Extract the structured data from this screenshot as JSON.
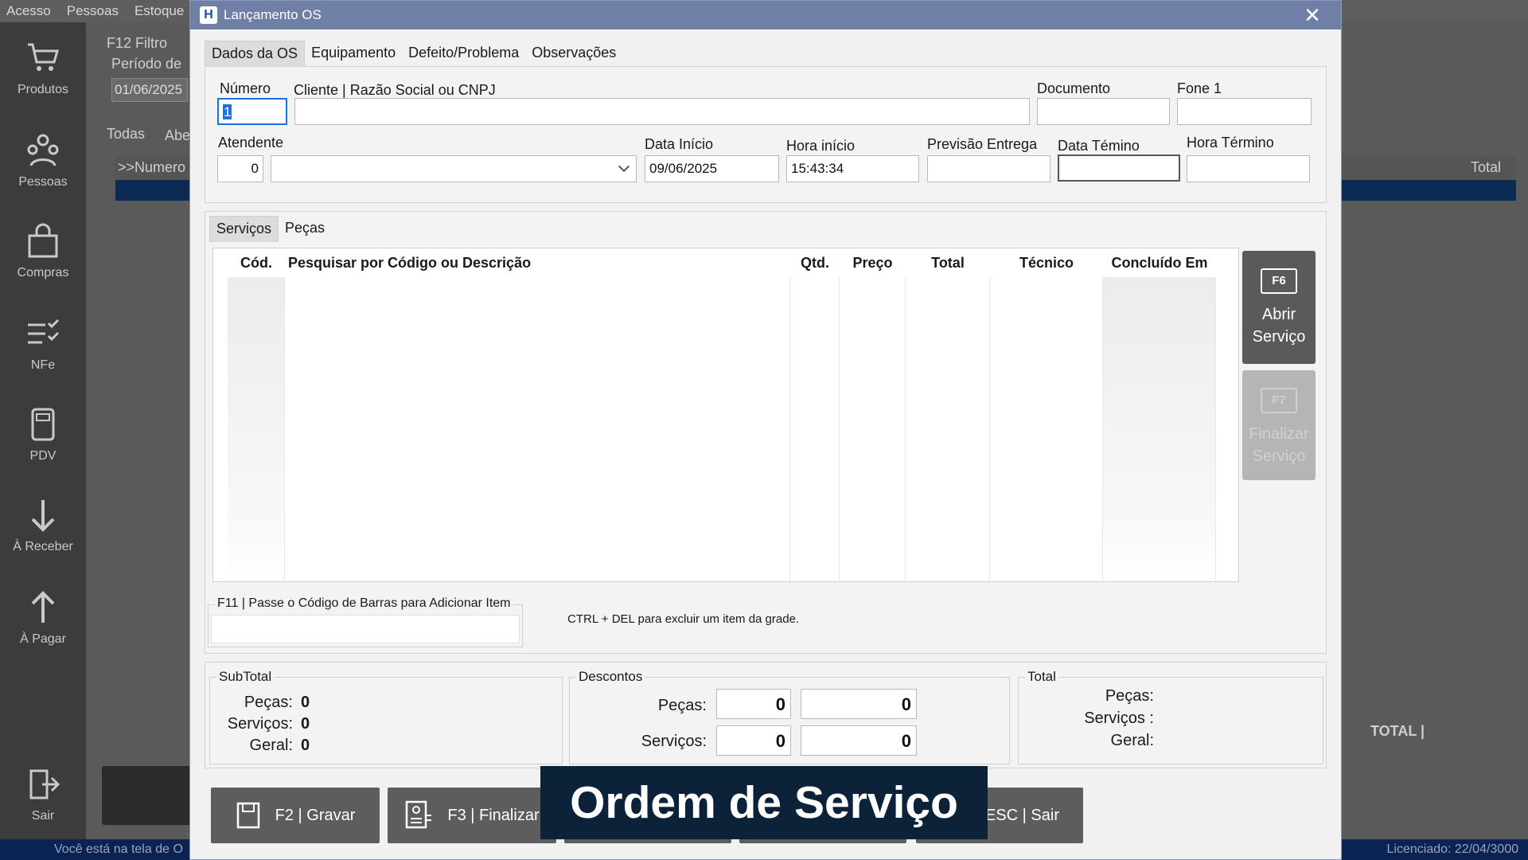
{
  "background": {
    "menu": [
      "Acesso",
      "Pessoas",
      "Estoque"
    ],
    "sidebar": [
      "Produtos",
      "Pessoas",
      "Compras",
      "NFe",
      "PDV",
      "À Receber",
      "À Pagar",
      "Sair"
    ],
    "filter_label": "F12 Filtro",
    "period_label": "Período de",
    "period_date": "01/06/2025",
    "tab_all": "Todas",
    "tab_open": "Abe",
    "grid_col": ">>Numero",
    "grid_total": "Total",
    "total_label": "TOTAL  |",
    "status_left": "Você está na tela de O",
    "status_right": "Licenciado: 22/04/3000"
  },
  "window": {
    "title": "Lançamento OS",
    "logo": "H",
    "close_icon": "close-icon"
  },
  "tabs": [
    "Dados da OS",
    "Equipamento",
    "Defeito/Problema",
    "Observações"
  ],
  "form": {
    "numero_label": "Número",
    "numero_value": "1",
    "cliente_label": "Cliente | Razão Social ou CNPJ",
    "cliente_value": "",
    "documento_label": "Documento",
    "documento_value": "",
    "fone_label": "Fone 1",
    "fone_value": "",
    "atendente_label": "Atendente",
    "atendente_code": "0",
    "atendente_name": "",
    "data_inicio_label": "Data Início",
    "data_inicio_value": "09/06/2025",
    "hora_inicio_label": "Hora início",
    "hora_inicio_value": "15:43:34",
    "previsao_label": "Previsão Entrega",
    "previsao_value": "",
    "data_termino_label": "Data Témino",
    "data_termino_value": "",
    "hora_termino_label": "Hora Término",
    "hora_termino_value": ""
  },
  "subtabs": [
    "Serviços",
    "Peças"
  ],
  "grid": {
    "columns": [
      "Cód.",
      "Pesquisar por Código ou Descrição",
      "Qtd.",
      "Preço",
      "Total",
      "Técnico",
      "Concluído Em"
    ],
    "rows": []
  },
  "side_buttons": {
    "open_key": "F6",
    "open_label1": "Abrir",
    "open_label2": "Serviço",
    "finish_key": "F7",
    "finish_label1": "Finalizar",
    "finish_label2": "Serviço"
  },
  "barcode": {
    "label": "F11 | Passe o Código de Barras para Adicionar Item",
    "value": ""
  },
  "hint": "CTRL + DEL para excluir um item da grade.",
  "subtotal": {
    "title": "SubTotal",
    "pecas_label": "Peças:",
    "pecas_value": "0",
    "servicos_label": "Serviços:",
    "servicos_value": "0",
    "geral_label": "Geral:",
    "geral_value": "0"
  },
  "descontos": {
    "title": "Descontos",
    "pecas_label": "Peças:",
    "pecas_pct": "0",
    "pecas_val": "0",
    "servicos_label": "Serviços:",
    "servicos_pct": "0",
    "servicos_val": "0"
  },
  "total": {
    "title": "Total",
    "pecas_label": "Peças:",
    "servicos_label": "Serviços :",
    "geral_label": "Geral:"
  },
  "buttons": {
    "save": "F2 | Gravar",
    "finish": "F3 | Finalizar",
    "exit": "ESC | Sair"
  },
  "caption": "Ordem de Serviço"
}
